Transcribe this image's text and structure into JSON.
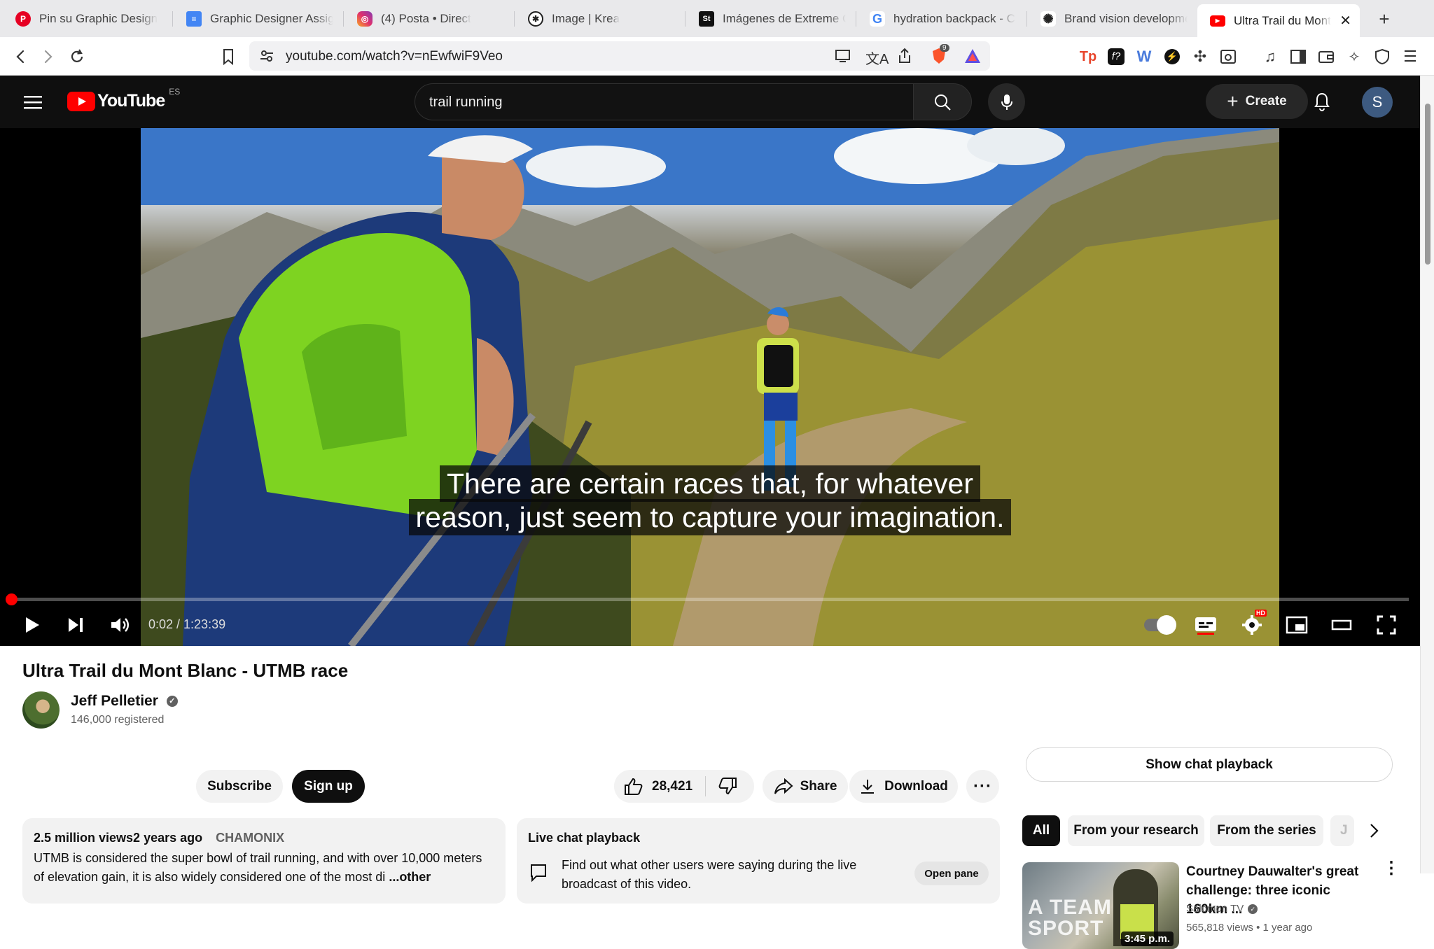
{
  "browser": {
    "tabs": [
      {
        "label": "Pin su Graphic Design",
        "icon": "pinterest-icon"
      },
      {
        "label": "Graphic Designer Assig",
        "icon": "google-docs-icon"
      },
      {
        "label": "(4) Posta • Direct",
        "icon": "instagram-icon"
      },
      {
        "label": "Image | Krea",
        "icon": "krea-icon"
      },
      {
        "label": "Imágenes de Extreme C",
        "icon": "stock-icon"
      },
      {
        "label": "hydration backpack - C",
        "icon": "google-icon"
      },
      {
        "label": "Brand vision developme",
        "icon": "openai-icon"
      },
      {
        "label": "Ultra Trail du Mont",
        "icon": "youtube-icon",
        "active": true
      }
    ],
    "url": "youtube.com/watch?v=nEwfwiF9Veo",
    "brave_badge": "9"
  },
  "youtube": {
    "logo_text": "YouTube",
    "region": "ES",
    "search_value": "trail running",
    "create_label": "Create",
    "avatar_letter": "S"
  },
  "player": {
    "subtitle_line1": "There are certain races that, for whatever",
    "subtitle_line2": "reason, just seem to capture your imagination.",
    "time": "0:02 / 1:23:39",
    "progress": 0.0004,
    "hd_badge": "HD"
  },
  "video": {
    "title": "Ultra Trail du Mont Blanc - UTMB race",
    "channel": "Jeff Pelletier",
    "subscribers": "146,000 registered",
    "subscribe_label": "Subscribe",
    "signup_label": "Sign up",
    "likes": "28,421",
    "share_label": "Share",
    "download_label": "Download"
  },
  "description": {
    "meta": "2.5 million views2 years ago",
    "location": "CHAMONIX",
    "text": "UTMB is considered the super bowl of trail running, and with over 10,000 meters of elevation gain, it is also widely considered one of the most di",
    "more": "...other"
  },
  "live_chat": {
    "title": "Live chat playback",
    "body": "Find out what other users were saying during the live broadcast of this video.",
    "open_label": "Open pane"
  },
  "sidebar": {
    "show_chat_label": "Show chat playback",
    "chips": [
      "All",
      "From your research",
      "From the series",
      "J"
    ],
    "recommended": [
      {
        "title": "Courtney Dauwalter's great challenge: three iconic 160km ...",
        "channel": "Salomon TV",
        "meta": "565,818 views • 1 year ago",
        "duration": "3:45 p.m.",
        "thumb_text": "A TEAM SPORT"
      }
    ]
  }
}
